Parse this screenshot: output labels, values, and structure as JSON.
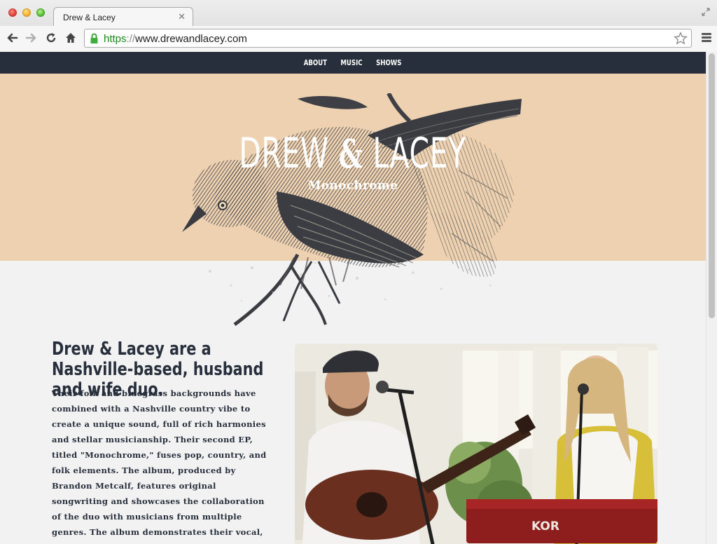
{
  "browser": {
    "tab_title": "Drew & Lacey",
    "url_scheme": "https",
    "url_sep": "://",
    "url_host": "www.drewandlacey.com",
    "icons": {
      "back": "back-arrow-icon",
      "forward": "forward-arrow-icon",
      "reload": "reload-icon",
      "home": "home-icon",
      "lock": "lock-icon",
      "star": "star-icon",
      "menu": "menu-icon",
      "close": "close-icon",
      "restore": "restore-icon"
    }
  },
  "site": {
    "nav": [
      {
        "label": "ABOUT"
      },
      {
        "label": "MUSIC"
      },
      {
        "label": "SHOWS"
      }
    ],
    "hero": {
      "title_left": "DREW",
      "title_amp": "&",
      "title_right": "LACEY",
      "subtitle": "Monochrome"
    },
    "about": {
      "headline": "Drew & Lacey are a Nashville-based, husband and wife duo.",
      "bio": "Their folk and bluegrass backgrounds have combined with a Nashville country vibe to create a unique sound, full of rich harmonies and stellar musicianship. Their second EP, titled \"Monochrome,\" fuses pop, country, and folk elements. The album, produced by Brandon Metcalf, features original songwriting and showcases the collaboration of the duo with musicians from multiple genres. The album demonstrates their vocal, instrumental, and songwriting talent.",
      "photo_keyboard_brand": "KOR"
    }
  },
  "colors": {
    "nav_bg": "#262f3b",
    "hero_bg": "#edd1b1",
    "text": "#262f3b",
    "page_bg": "#f2f2f2"
  }
}
